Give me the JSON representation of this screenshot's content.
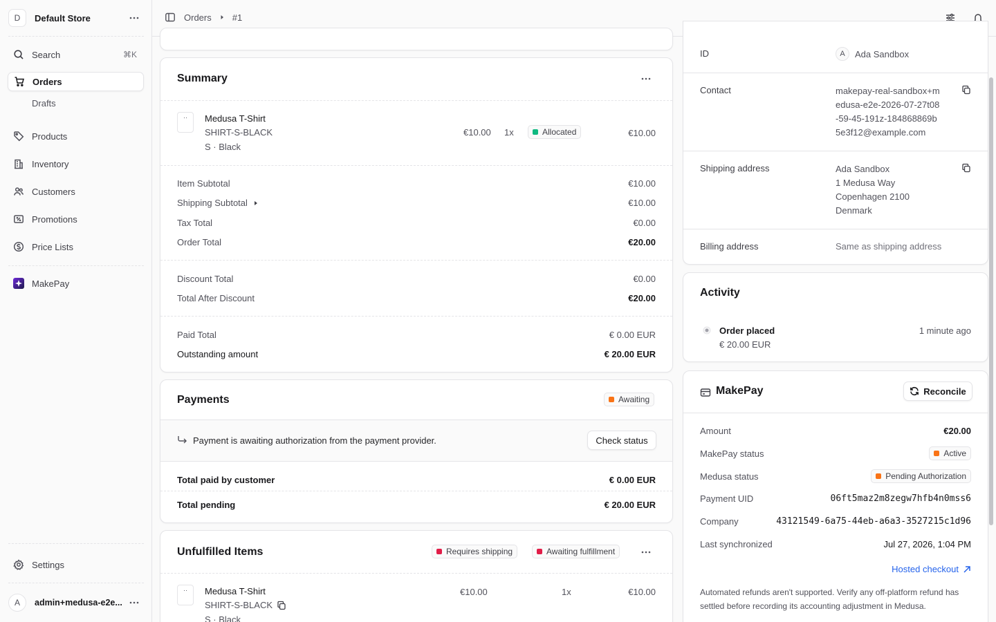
{
  "sidebar": {
    "store": {
      "avatar": "D",
      "name": "Default Store"
    },
    "search": {
      "label": "Search",
      "shortcut": "⌘K"
    },
    "items": [
      {
        "label": "Orders",
        "icon": "shopping-cart-icon",
        "active": true
      },
      {
        "label": "Drafts",
        "sub": true
      },
      {
        "label": "Products",
        "icon": "tag-icon"
      },
      {
        "label": "Inventory",
        "icon": "building-icon"
      },
      {
        "label": "Customers",
        "icon": "users-icon"
      },
      {
        "label": "Promotions",
        "icon": "receipt-percent-icon"
      },
      {
        "label": "Price Lists",
        "icon": "currency-dollar-icon"
      }
    ],
    "extension": {
      "label": "MakePay",
      "icon": "makepay-logo-icon"
    },
    "settings": {
      "label": "Settings",
      "icon": "gear-icon"
    },
    "user": {
      "avatar": "A",
      "name": "admin+medusa-e2e..."
    }
  },
  "topbar": {
    "crumb_root": "Orders",
    "crumb_current": "#1"
  },
  "summary": {
    "title": "Summary",
    "item": {
      "thumb": "··",
      "name": "Medusa T-Shirt",
      "sku": "SHIRT-S-BLACK",
      "variant": "S · Black",
      "unit_price": "€10.00",
      "qty": "1x",
      "status": "Allocated",
      "total": "€10.00"
    },
    "totals": [
      {
        "label": "Item Subtotal",
        "value": "€10.00"
      },
      {
        "label": "Shipping Subtotal",
        "value": "€10.00"
      },
      {
        "label": "Tax Total",
        "value": "€0.00"
      },
      {
        "label": "Order Total",
        "value": "€20.00"
      }
    ],
    "discounts": [
      {
        "label": "Discount Total",
        "value": "€0.00"
      },
      {
        "label": "Total After Discount",
        "value": "€20.00"
      }
    ],
    "paid": [
      {
        "label": "Paid Total",
        "value": "€ 0.00 EUR"
      },
      {
        "label": "Outstanding amount",
        "value": "€ 20.00 EUR"
      }
    ]
  },
  "payments": {
    "title": "Payments",
    "status": "Awaiting",
    "notice": "Payment is awaiting authorization from the payment provider.",
    "check_button": "Check status",
    "rows": [
      {
        "label": "Total paid by customer",
        "value": "€ 0.00 EUR"
      },
      {
        "label": "Total pending",
        "value": "€ 20.00 EUR"
      }
    ]
  },
  "unfulfilled": {
    "title": "Unfulfilled Items",
    "badge_shipping": "Requires shipping",
    "badge_fulfillment": "Awaiting fulfillment",
    "item": {
      "thumb": "··",
      "name": "Medusa T-Shirt",
      "sku": "SHIRT-S-BLACK",
      "variant": "S · Black",
      "unit_price": "€10.00",
      "qty": "1x",
      "total": "€10.00"
    }
  },
  "customer": {
    "id_label": "ID",
    "id_avatar": "A",
    "id_value": "Ada Sandbox",
    "contact_label": "Contact",
    "contact_lines": [
      "makepay-real-sandbox+m",
      "edusa-e2e-2026-07-27t08",
      "-59-45-191z-184868869b",
      "5e3f12@example.com"
    ],
    "shipping_label": "Shipping address",
    "shipping_lines": [
      "Ada Sandbox",
      "1 Medusa Way",
      "Copenhagen 2100",
      "Denmark"
    ],
    "billing_label": "Billing address",
    "billing_value": "Same as shipping address"
  },
  "activity": {
    "title": "Activity",
    "event": "Order placed",
    "amount": "€ 20.00 EUR",
    "time": "1 minute ago"
  },
  "makepay": {
    "title": "MakePay",
    "reconcile_button": "Reconcile",
    "rows": [
      {
        "label": "Amount",
        "value": "€20.00"
      },
      {
        "label": "MakePay status",
        "value": "Active"
      },
      {
        "label": "Medusa status",
        "value": "Pending Authorization"
      },
      {
        "label": "Payment UID",
        "value": "06ft5maz2m8zegw7hfb4n0mss6"
      },
      {
        "label": "Company",
        "value": "43121549-6a75-44eb-a6a3-3527215c1d96"
      },
      {
        "label": "Last synchronized",
        "value": "Jul 27, 2026, 1:04 PM"
      }
    ],
    "hosted_link": "Hosted checkout",
    "note": "Automated refunds aren't supported. Verify any off-platform refund has settled before recording its accounting adjustment in Medusa."
  },
  "colors": {
    "accent": "#2563eb",
    "success": "#10b981",
    "warning": "#f97316",
    "danger": "#e11d48"
  }
}
